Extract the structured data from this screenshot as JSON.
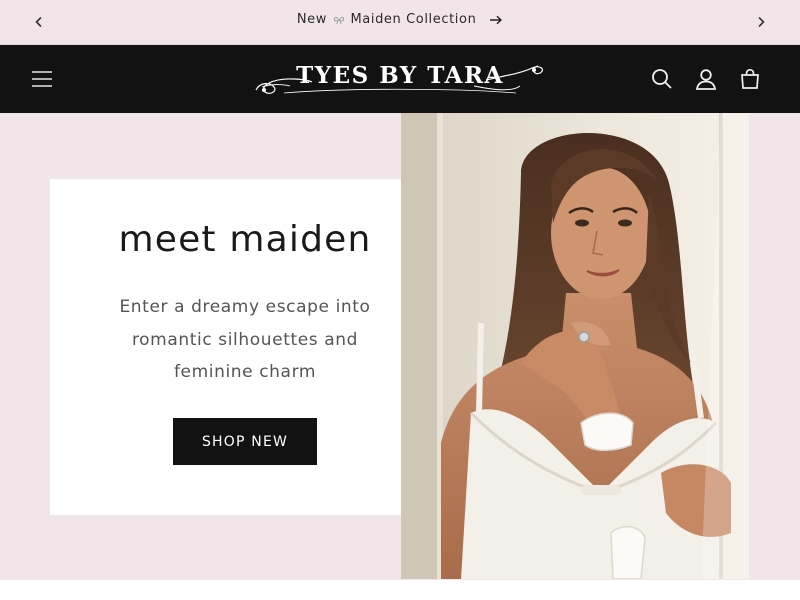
{
  "announcement": {
    "prefix": "New",
    "suffix": "Maiden Collection",
    "prev_icon": "chevron-left-icon",
    "next_icon": "chevron-right-icon",
    "link_icon": "arrow-right-icon"
  },
  "header": {
    "logo_text": "TYES BY TARA",
    "menu_icon": "hamburger-menu-icon",
    "search_icon": "search-icon",
    "account_icon": "user-icon",
    "cart_icon": "cart-icon"
  },
  "hero": {
    "title": "meet maiden",
    "text": "Enter a dreamy escape into romantic silhouettes and feminine charm",
    "button_label": "SHOP NEW"
  },
  "colors": {
    "announcement_bg": "#f1e5e9",
    "header_bg": "#121212",
    "hero_bg": "#f1e5e9",
    "button_bg": "#121212"
  }
}
